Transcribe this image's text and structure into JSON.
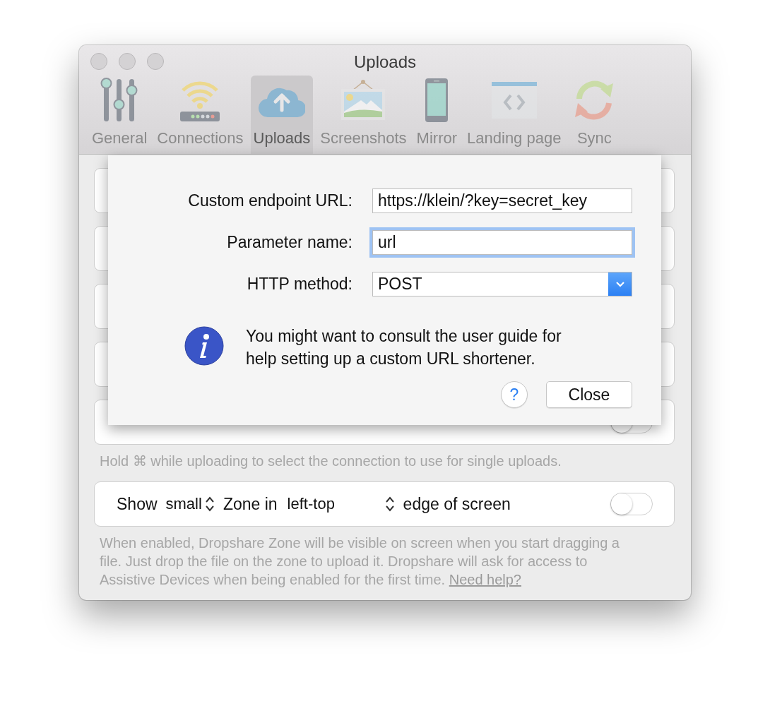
{
  "window": {
    "title": "Uploads"
  },
  "toolbar": [
    {
      "label": "General",
      "kind": "sliders",
      "selected": false
    },
    {
      "label": "Connections",
      "kind": "router",
      "selected": false
    },
    {
      "label": "Uploads",
      "kind": "cloud",
      "selected": true
    },
    {
      "label": "Screenshots",
      "kind": "frame",
      "selected": false
    },
    {
      "label": "Mirror",
      "kind": "phone",
      "selected": false
    },
    {
      "label": "Landing page",
      "kind": "browser",
      "selected": false
    },
    {
      "label": "Sync",
      "kind": "sync",
      "selected": false
    }
  ],
  "connection_row": {
    "on": false
  },
  "connection_hint": "Hold ⌘ while uploading to select the connection to use for single uploads.",
  "zone_row": {
    "show_label": "Show",
    "size": "small",
    "zone_label": "Zone in",
    "position": "left-top",
    "suffix": "edge of screen",
    "on": false
  },
  "zone_hint": "When enabled, Dropshare Zone will be visible on screen when you start dragging a file. Just drop the file on the zone to upload it. Dropshare will ask for access to Assistive Devices when being enabled for the first time.",
  "zone_help_link": "Need help?",
  "sheet": {
    "fields": [
      {
        "label": "Custom endpoint URL:",
        "kind": "text",
        "value": "https://klein/?key=secret_key",
        "focused": false
      },
      {
        "label": "Parameter name:",
        "kind": "text",
        "value": "url",
        "focused": true
      },
      {
        "label": "HTTP method:",
        "kind": "select",
        "value": "POST",
        "focused": false
      }
    ],
    "info": "You might want to consult the user guide for help setting up a custom URL shortener.",
    "help_button": "?",
    "close_button": "Close"
  }
}
